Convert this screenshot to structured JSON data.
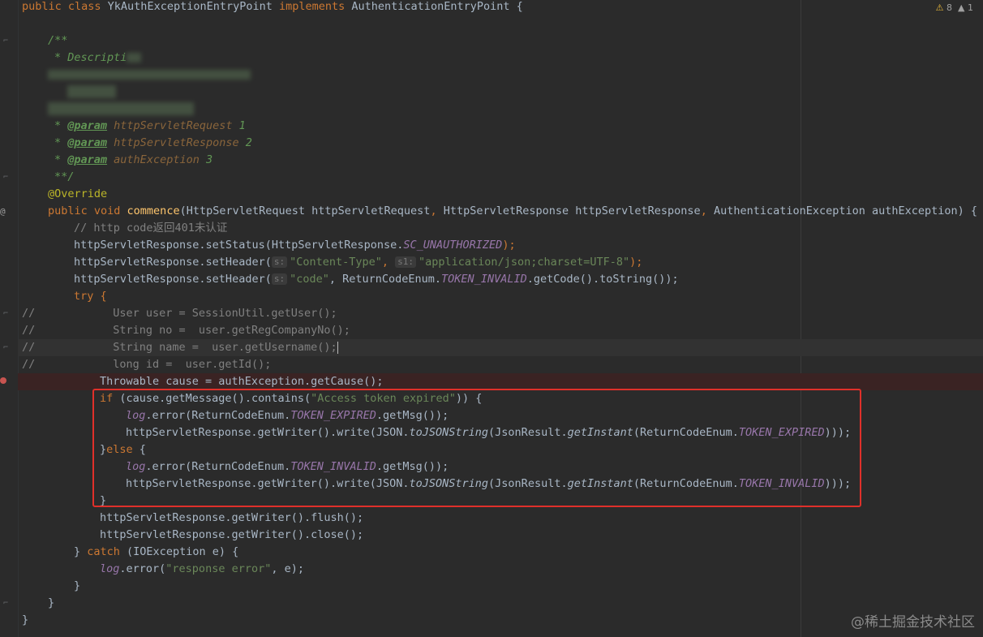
{
  "inspections": {
    "warnings": "8",
    "weak_warnings": "1",
    "warn_symbol": "⚠",
    "weak_symbol": "▲"
  },
  "watermark": "@稀土掘金技术社区",
  "code": {
    "l1": {
      "a": "public class ",
      "b": "YkAuthExceptionEntryPoint ",
      "c": "implements ",
      "d": "AuthenticationEntryPoint {"
    },
    "l2_doc_open": "/**",
    "l3_doc": "* Descripti",
    "param1": {
      "star": "* ",
      "tag": "@param",
      "name": " httpServletRequest",
      "num": " 1"
    },
    "param2": {
      "star": "* ",
      "tag": "@param",
      "name": " httpServletResponse",
      "num": " 2"
    },
    "param3": {
      "star": "* ",
      "tag": "@param",
      "name": " authException",
      "num": " 3"
    },
    "doc_close": "**/",
    "override": "@Override",
    "sig": {
      "a": "public void ",
      "b": "commence",
      "c": "(HttpServletRequest httpServletRequest",
      "d": ", ",
      "e": "HttpServletResponse httpServletResponse",
      "f": ", ",
      "g": "AuthenticationException authException) {"
    },
    "cmt_401": "// http code返回401未认证",
    "set_status": {
      "a": "httpServletResponse.setStatus(HttpServletResponse.",
      "b": "SC_UNAUTHORIZED",
      "c": ");"
    },
    "set_header1": {
      "a": "httpServletResponse.setHeader(",
      "h1": "s:",
      "b": "\"Content-Type\"",
      "c": ", ",
      "h2": "s1:",
      "d": "\"application/json;charset=UTF-8\"",
      "e": ");"
    },
    "set_header2": {
      "a": "httpServletResponse.setHeader(",
      "h1": "s:",
      "b": "\"code\"",
      "c": ", ReturnCodeEnum.",
      "d": "TOKEN_INVALID",
      "e": ".getCode().toString());"
    },
    "try": "try {",
    "c1": {
      "slashes": "//",
      "code": "User user = SessionUtil.getUser();"
    },
    "c2": {
      "slashes": "//",
      "code": "String no =  user.getRegCompanyNo();"
    },
    "c3": {
      "slashes": "//",
      "code": "String name =  user.getUsername();"
    },
    "c4": {
      "slashes": "//",
      "code": "long id =  user.getId();"
    },
    "throwable": "Throwable cause = authException.getCause();",
    "if": {
      "a": "if ",
      "b": "(cause.getMessage().contains(",
      "c": "\"Access token expired\"",
      "d": ")) {"
    },
    "log1": {
      "a": "log",
      "b": ".error(ReturnCodeEnum.",
      "c": "TOKEN_EXPIRED",
      "d": ".getMsg());"
    },
    "write1": {
      "a": "httpServletResponse.getWriter().write(JSON.",
      "b": "toJSONString",
      "c": "(JsonResult.",
      "d": "getInstant",
      "e": "(ReturnCodeEnum.",
      "f": "TOKEN_EXPIRED",
      "g": ")));"
    },
    "else": {
      "a": "}",
      "b": "else ",
      "c": "{"
    },
    "log2": {
      "a": "log",
      "b": ".error(ReturnCodeEnum.",
      "c": "TOKEN_INVALID",
      "d": ".getMsg());"
    },
    "write2": {
      "a": "httpServletResponse.getWriter().write(JSON.",
      "b": "toJSONString",
      "c": "(JsonResult.",
      "d": "getInstant",
      "e": "(ReturnCodeEnum.",
      "f": "TOKEN_INVALID",
      "g": ")));"
    },
    "close_brace": "}",
    "flush": "httpServletResponse.getWriter().flush();",
    "close": "httpServletResponse.getWriter().close();",
    "catch": {
      "a": "} ",
      "b": "catch ",
      "c": "(IOException e) {"
    },
    "log3": {
      "a": "log",
      "b": ".error(",
      "c": "\"response error\"",
      "d": ", e);"
    },
    "cb1": "}",
    "cb2": "}",
    "cb3": "}"
  }
}
